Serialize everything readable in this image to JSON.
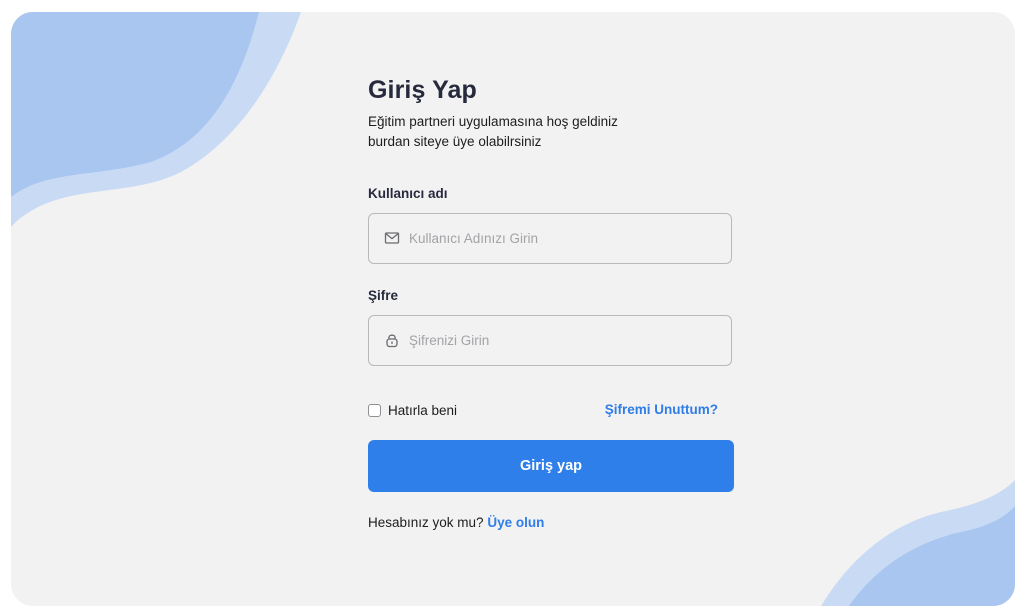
{
  "login": {
    "title": "Giriş Yap",
    "subtitle_line1": "Eğitim partneri uygulamasına hoş geldiniz",
    "subtitle_line2": "burdan siteye üye olabilrsiniz",
    "username_label": "Kullanıcı adı",
    "username_placeholder": "Kullanıcı Adınızı Girin",
    "username_value": "",
    "password_label": "Şifre",
    "password_placeholder": "Şifrenizi Girin",
    "password_value": "",
    "remember_label": "Hatırla beni",
    "remember_checked": false,
    "forgot_link": "Şifremi Unuttum?",
    "submit_label": "Giriş yap",
    "signup_prompt": "Hesabınız yok mu?",
    "signup_link": "Üye olun"
  },
  "icons": {
    "username_field": "mail-icon",
    "password_field": "lock-icon"
  },
  "colors": {
    "accent": "#2f7fea",
    "link": "#2f7de8",
    "card_background": "#f2f2f2",
    "wave_light": "#c9dbf4",
    "wave_dark": "#a8c6f0",
    "title_text": "#27293d"
  }
}
